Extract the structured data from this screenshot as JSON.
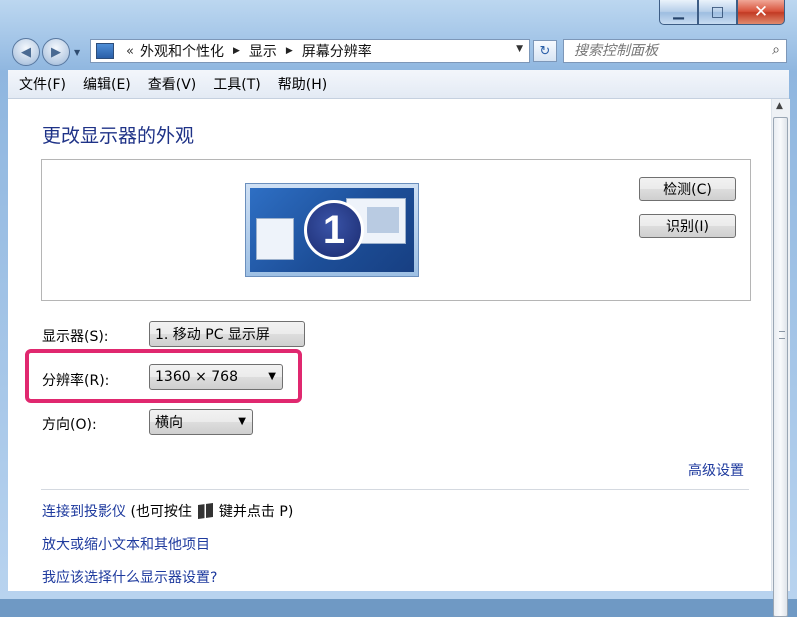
{
  "window": {
    "minimize_glyph": "▁",
    "maximize_glyph": "□",
    "close_glyph": "✕"
  },
  "nav": {
    "back_glyph": "◀",
    "forward_glyph": "▶",
    "breadcrumb_chevron": "«",
    "breadcrumb": [
      "外观和个性化",
      "显示",
      "屏幕分辨率"
    ],
    "crumb_sep": "▶",
    "refresh_glyph": "↻",
    "search_placeholder": "搜索控制面板",
    "search_icon": "search-icon",
    "search_glyph": "⌕"
  },
  "menu": {
    "items": [
      "文件(F)",
      "编辑(E)",
      "查看(V)",
      "工具(T)",
      "帮助(H)"
    ]
  },
  "main": {
    "heading": "更改显示器的外观",
    "monitor_number": "1",
    "detect_label": "检测(C)",
    "identify_label": "识别(I)",
    "display_label": "显示器(S):",
    "display_value": "1. 移动 PC 显示屏",
    "resolution_label": "分辨率(R):",
    "resolution_value": "1360 × 768",
    "orientation_label": "方向(O):",
    "orientation_value": "横向",
    "dropdown_arrow": "▼",
    "advanced_link": "高级设置",
    "projector_link": "连接到投影仪",
    "projector_hint_before": "(也可按住",
    "projector_hint_after": "键并点击 P)",
    "zoom_link": "放大或缩小文本和其他项目",
    "help_link": "我应该选择什么显示器设置?"
  },
  "colors": {
    "link": "#1e3a9e",
    "heading": "#1e3287",
    "highlight": "#e0286f"
  }
}
